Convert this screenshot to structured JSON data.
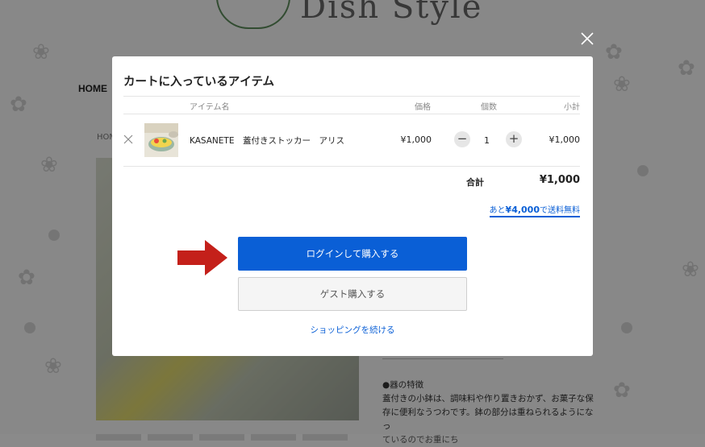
{
  "background": {
    "logo_text": "Dish Style",
    "nav_home": "HOME",
    "breadcrumb": "HOM",
    "description_lines": [
      "●器の特徴",
      "蓋付きの小鉢は、調味料や作り置きおかず、お菓子な保",
      "存に便利なうつわです。鉢の部分は重ねられるようになっ",
      "ているのでお重にち"
    ]
  },
  "modal": {
    "title": "カートに入っているアイテム",
    "columns": {
      "item_name": "アイテム名",
      "price": "価格",
      "quantity": "個数",
      "subtotal": "小計"
    },
    "items": [
      {
        "name": "KASANETE　蓋付きストッカー　アリス",
        "price": "¥1,000",
        "quantity": "1",
        "subtotal": "¥1,000"
      }
    ],
    "total_label": "合計",
    "total_value": "¥1,000",
    "free_shipping": {
      "prefix": "あと",
      "amount": "¥4,000",
      "suffix": "で送料無料"
    },
    "login_button": "ログインして購入する",
    "guest_button": "ゲスト購入する",
    "continue_link": "ショッピングを続ける"
  },
  "colors": {
    "primary": "#0a5fd6",
    "arrow": "#c4201a"
  }
}
